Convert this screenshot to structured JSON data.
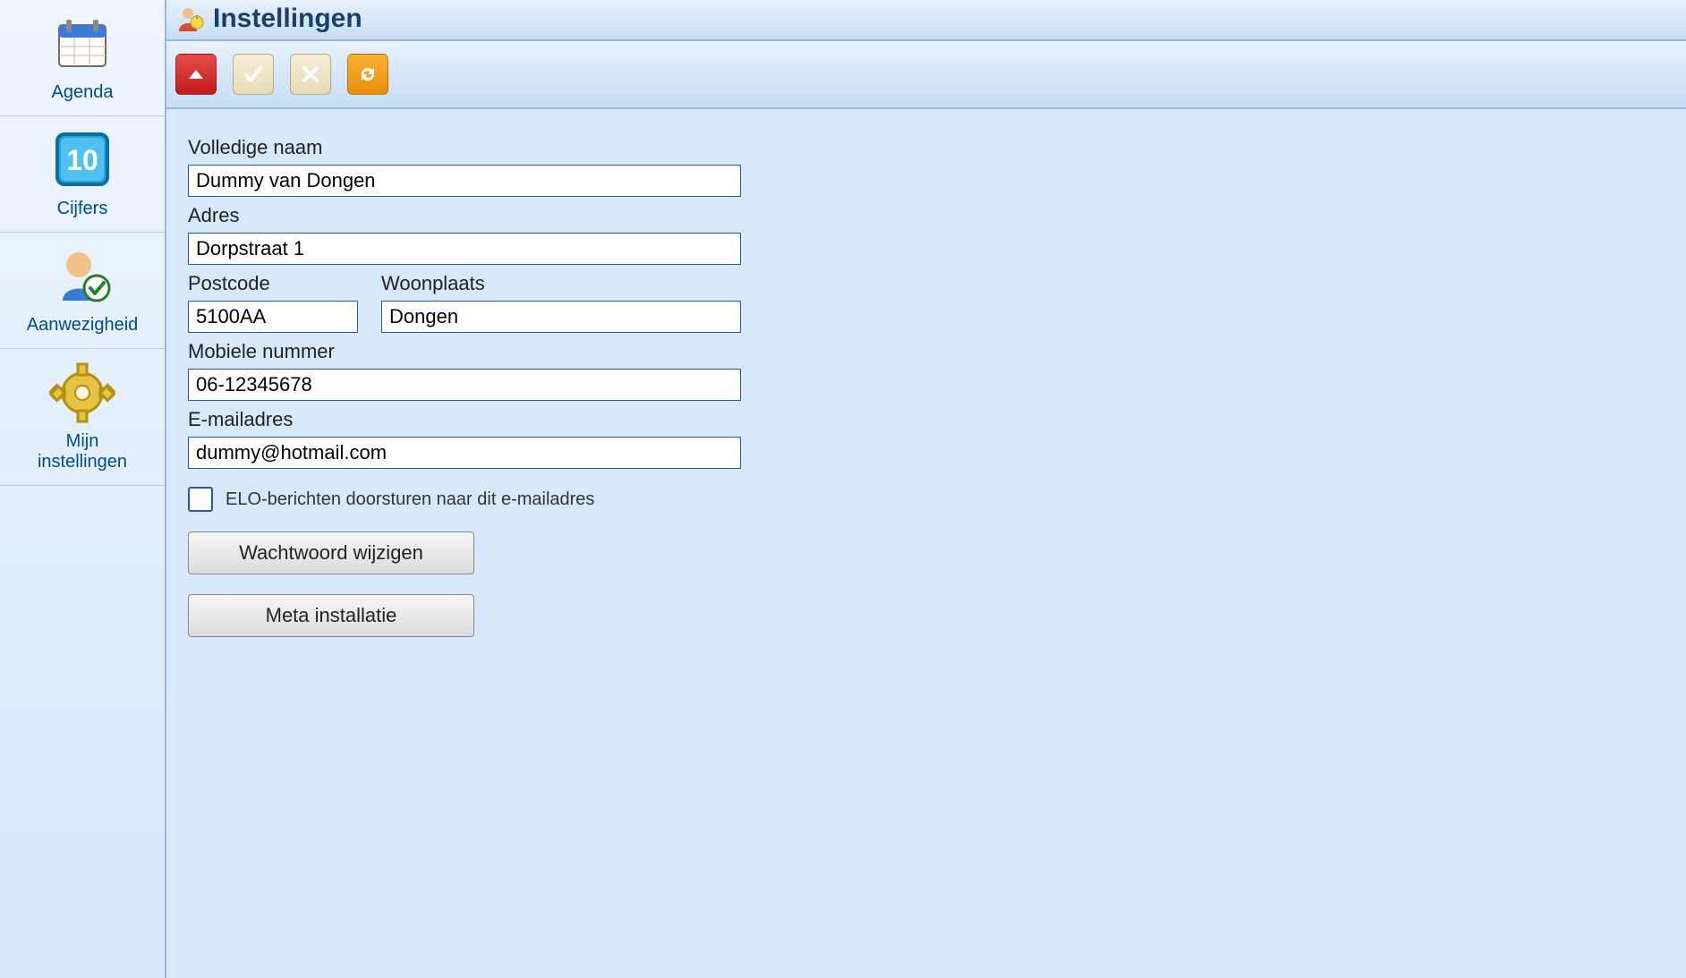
{
  "sidebar": {
    "items": [
      {
        "label": "Agenda"
      },
      {
        "label": "Cijfers",
        "badge_number": "10"
      },
      {
        "label": "Aanwezigheid"
      },
      {
        "label": "Mijn\ninstellingen"
      }
    ]
  },
  "header": {
    "title": "Instellingen"
  },
  "form": {
    "fullname_label": "Volledige naam",
    "fullname_value": "Dummy van Dongen",
    "address_label": "Adres",
    "address_value": "Dorpstraat 1",
    "postcode_label": "Postcode",
    "postcode_value": "5100AA",
    "city_label": "Woonplaats",
    "city_value": "Dongen",
    "mobile_label": "Mobiele nummer",
    "mobile_value": "06-12345678",
    "email_label": "E-mailadres",
    "email_value": "dummy@hotmail.com",
    "forward_checkbox_label": "ELO-berichten doorsturen naar dit e-mailadres",
    "forward_checked": false,
    "change_password_btn": "Wachtwoord wijzigen",
    "meta_install_btn": "Meta installatie"
  }
}
